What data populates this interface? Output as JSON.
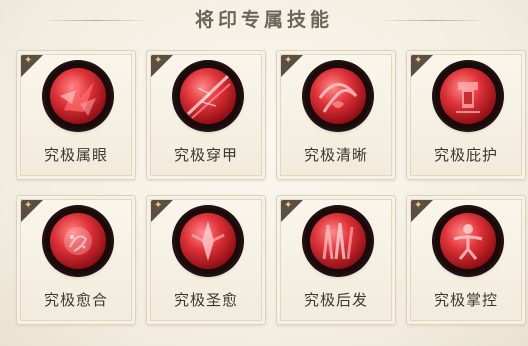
{
  "panel": {
    "title": "将印专属技能"
  },
  "skills": [
    {
      "label": "究极属眼",
      "icon": "claw-burst-icon"
    },
    {
      "label": "究极穿甲",
      "icon": "piercing-slash-icon"
    },
    {
      "label": "究极清晰",
      "icon": "swirl-heart-icon"
    },
    {
      "label": "究极庇护",
      "icon": "shield-bell-icon"
    },
    {
      "label": "究极愈合",
      "icon": "healing-glow-icon"
    },
    {
      "label": "究极圣愈",
      "icon": "holy-heal-icon"
    },
    {
      "label": "究极后发",
      "icon": "counter-strike-icon"
    },
    {
      "label": "究极掌控",
      "icon": "control-figure-icon"
    }
  ],
  "colors": {
    "accent_red": "#d0262c",
    "tag_dark": "#5b4f44",
    "tag_gold": "#e9c982"
  }
}
